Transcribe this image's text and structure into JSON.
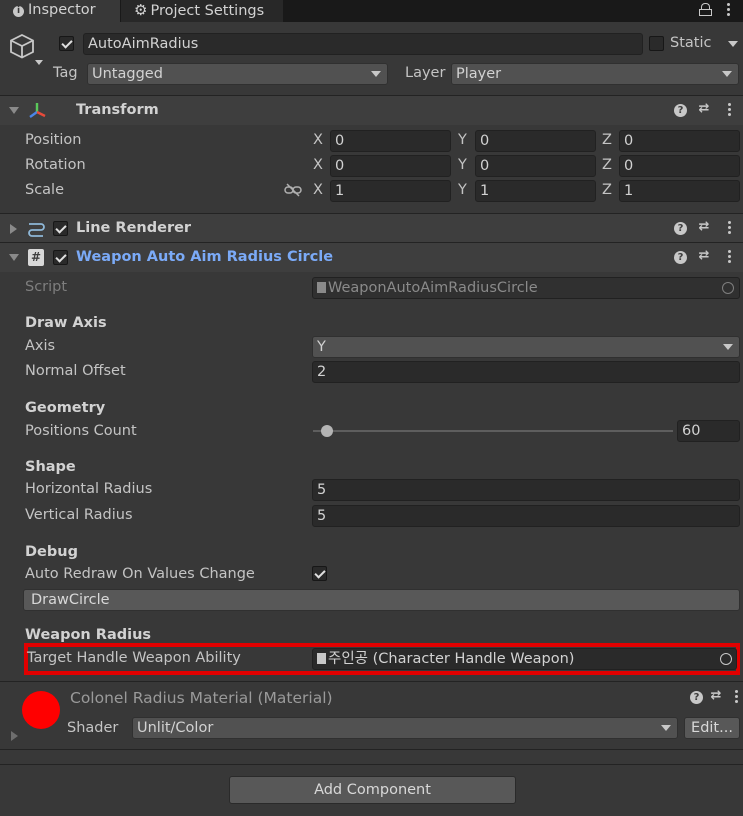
{
  "tabs": {
    "inspector": "Inspector",
    "project_settings": "Project Settings"
  },
  "object": {
    "name": "AutoAimRadius",
    "static_label": "Static",
    "tag_label": "Tag",
    "tag_value": "Untagged",
    "layer_label": "Layer",
    "layer_value": "Player"
  },
  "transform": {
    "title": "Transform",
    "rows": [
      {
        "label": "Position",
        "x": "0",
        "y": "0",
        "z": "0"
      },
      {
        "label": "Rotation",
        "x": "0",
        "y": "0",
        "z": "0"
      },
      {
        "label": "Scale",
        "x": "1",
        "y": "1",
        "z": "1"
      }
    ],
    "axis_x": "X",
    "axis_y": "Y",
    "axis_z": "Z"
  },
  "line_renderer": {
    "title": "Line Renderer"
  },
  "weapon_circle": {
    "title": "Weapon Auto Aim Radius Circle",
    "script_label": "Script",
    "script_value": "WeaponAutoAimRadiusCircle",
    "draw_axis_header": "Draw Axis",
    "axis_label": "Axis",
    "axis_value": "Y",
    "normal_offset_label": "Normal Offset",
    "normal_offset_value": "2",
    "geometry_header": "Geometry",
    "positions_count_label": "Positions Count",
    "positions_count_value": "60",
    "shape_header": "Shape",
    "horizontal_radius_label": "Horizontal Radius",
    "horizontal_radius_value": "5",
    "vertical_radius_label": "Vertical Radius",
    "vertical_radius_value": "5",
    "debug_header": "Debug",
    "auto_redraw_label": "Auto Redraw On Values Change",
    "draw_circle_button": "DrawCircle",
    "weapon_radius_header": "Weapon Radius",
    "target_label": "Target Handle Weapon Ability",
    "target_value": "주인공 (Character Handle Weapon)"
  },
  "material": {
    "title": "Colonel Radius Material (Material)",
    "shader_label": "Shader",
    "shader_value": "Unlit/Color",
    "edit_button": "Edit...",
    "color": "#ff0000"
  },
  "add_component": "Add Component",
  "colors": {
    "highlight": "#e20000",
    "link_title": "#7baaf7"
  }
}
